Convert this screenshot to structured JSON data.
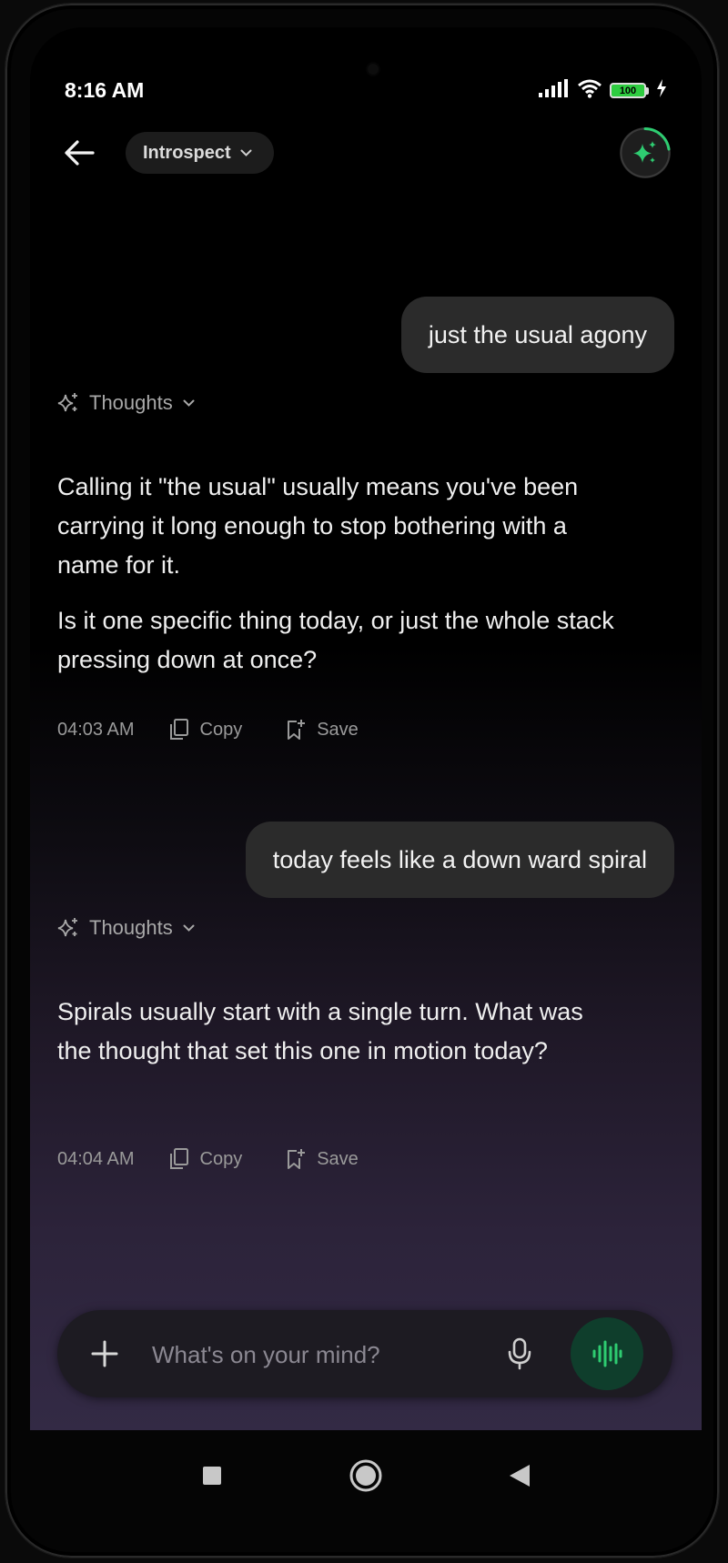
{
  "status_bar": {
    "time": "8:16 AM",
    "battery": "100"
  },
  "header": {
    "mode": "Introspect"
  },
  "messages": [
    {
      "user": "just the usual agony",
      "thoughts_label": "Thoughts",
      "paragraphs": [
        "Calling it \"the usual\" usually means you've been carrying it long enough to stop bothering with a name for it.",
        "Is it one specific thing today, or just the whole stack pressing down at once?"
      ],
      "time": "04:03 AM",
      "copy": "Copy",
      "save": "Save"
    },
    {
      "user": "today feels like a down ward spiral",
      "thoughts_label": "Thoughts",
      "paragraphs": [
        "Spirals usually start with a single turn. What was the thought that set this one in motion today?"
      ],
      "time": "04:04 AM",
      "copy": "Copy",
      "save": "Save"
    }
  ],
  "composer": {
    "placeholder": "What's on your mind?"
  },
  "colors": {
    "accent": "#2ecc71",
    "bubble": "#2b2b2b"
  }
}
